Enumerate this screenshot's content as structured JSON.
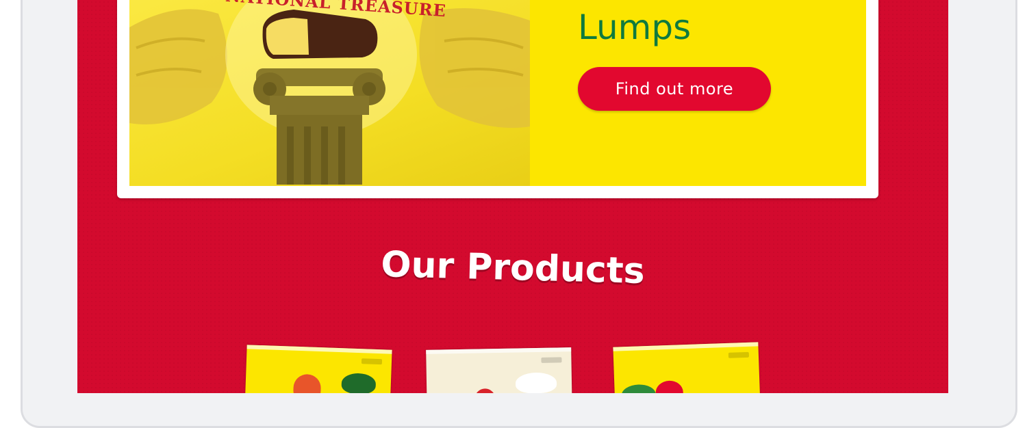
{
  "banner": {
    "medallion_text": "NATIONAL TREASURE",
    "promo_title_line2": "Lumps",
    "cta_label": "Find out more"
  },
  "products_section": {
    "title": "Our Products",
    "items": [
      {
        "color": "#fce600",
        "accent": "#e8552a"
      },
      {
        "color": "#f6efd8",
        "accent": "#d8232a"
      },
      {
        "color": "#fce600",
        "accent": "#2e8b3a"
      }
    ]
  },
  "colors": {
    "background": "#d30a2e",
    "banner_yellow": "#fce600",
    "title_green": "#0f7a3e",
    "cta_red": "#e2082f"
  }
}
